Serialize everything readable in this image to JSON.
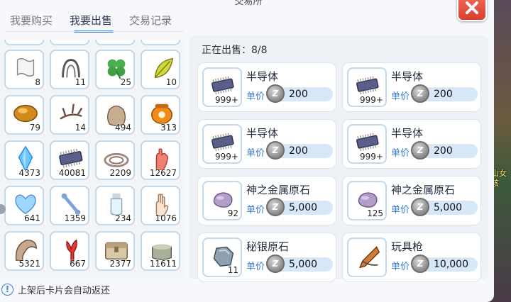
{
  "window": {
    "title": "交易所"
  },
  "tabs": [
    {
      "label": "我要购买",
      "active": false
    },
    {
      "label": "我要出售",
      "active": true
    },
    {
      "label": "交易记录",
      "active": false
    }
  ],
  "inventory": {
    "slots": [
      {
        "icon": "paper-scroll-icon",
        "count": "8"
      },
      {
        "icon": "iron-hook-icon",
        "count": "11"
      },
      {
        "icon": "clover-icon",
        "count": "25"
      },
      {
        "icon": "green-leaf-icon",
        "count": "10"
      },
      {
        "icon": "amber-stone-icon",
        "count": "79"
      },
      {
        "icon": "branch-icon",
        "count": "14"
      },
      {
        "icon": "cloth-bag-icon",
        "count": "494"
      },
      {
        "icon": "honey-pot-icon",
        "count": "313"
      },
      {
        "icon": "blue-crystal-icon",
        "count": "4373"
      },
      {
        "icon": "semiconductor-chip-icon",
        "count": "40081"
      },
      {
        "icon": "rope-coil-icon",
        "count": "2209"
      },
      {
        "icon": "red-glove-icon",
        "count": "12627"
      },
      {
        "icon": "blue-heart-icon",
        "count": "641"
      },
      {
        "icon": "bone-icon",
        "count": "1359"
      },
      {
        "icon": "bottle-icon",
        "count": "234"
      },
      {
        "icon": "hand-icon",
        "count": "1076"
      },
      {
        "icon": "horn-icon",
        "count": "5321"
      },
      {
        "icon": "red-coral-icon",
        "count": "667"
      },
      {
        "icon": "treasure-chest-icon",
        "count": "2377"
      },
      {
        "icon": "stone-pot-icon",
        "count": "11611"
      }
    ]
  },
  "notice": {
    "text": "上架后卡片会自动返还"
  },
  "selling": {
    "header": "正在出售：8/8",
    "price_label": "单价",
    "coin_symbol": "Z",
    "listings": [
      {
        "name": "半导体",
        "count": "999+",
        "price": "200",
        "icon": "semiconductor-chip-icon"
      },
      {
        "name": "半导体",
        "count": "999+",
        "price": "200",
        "icon": "semiconductor-chip-icon"
      },
      {
        "name": "半导体",
        "count": "999+",
        "price": "200",
        "icon": "semiconductor-chip-icon"
      },
      {
        "name": "半导体",
        "count": "999+",
        "price": "200",
        "icon": "semiconductor-chip-icon"
      },
      {
        "name": "神之金属原石",
        "count": "92",
        "price": "5,000",
        "icon": "purple-ore-icon"
      },
      {
        "name": "神之金属原石",
        "count": "125",
        "price": "5,000",
        "icon": "purple-ore-icon"
      },
      {
        "name": "秘银原石",
        "count": "11",
        "price": "5,000",
        "icon": "silver-ore-icon"
      },
      {
        "name": "玩具枪",
        "count": "",
        "price": "10,000",
        "icon": "toy-gun-icon"
      }
    ]
  },
  "side_text": "山女孩",
  "colors": {
    "accent": "#3f8be0",
    "close": "#e04a38",
    "slot_border": "#bfd9ef"
  }
}
